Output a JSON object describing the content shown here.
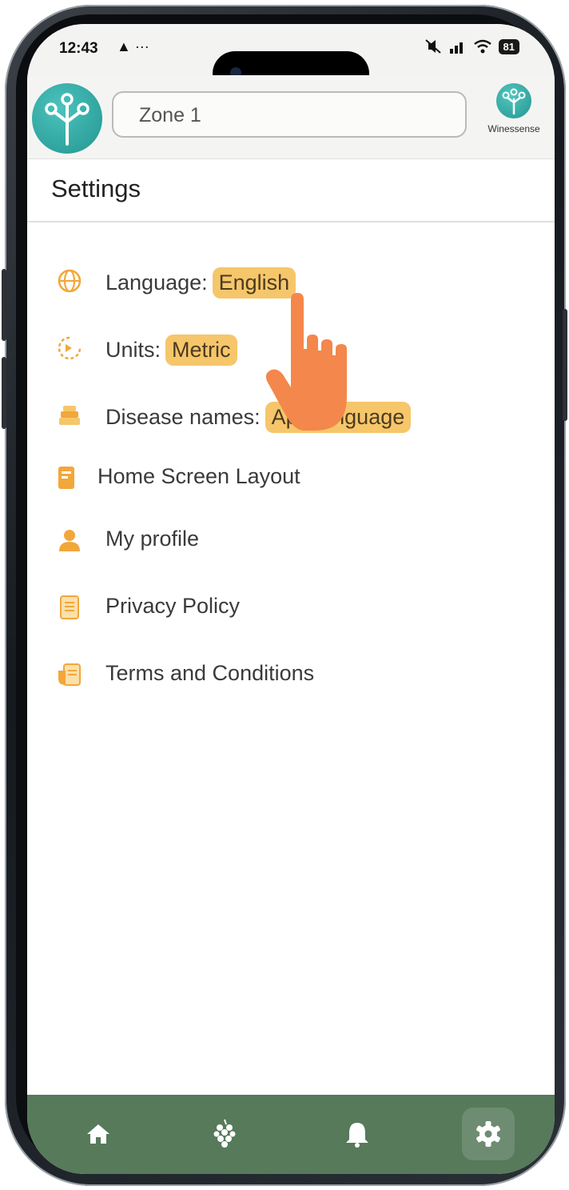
{
  "status_bar": {
    "time": "12:43",
    "indicators": "▲ ···",
    "battery": "81",
    "icons": [
      "cloud-icon",
      "mute-icon",
      "signal-icon",
      "wifi-icon",
      "battery-icon"
    ]
  },
  "header": {
    "zone_value": "Zone 1",
    "brand_name": "Winessense"
  },
  "page": {
    "title": "Settings"
  },
  "settings": {
    "items": [
      {
        "label": "Language:",
        "value": "English",
        "icon": "globe-icon"
      },
      {
        "label": "Units:",
        "value": "Metric",
        "icon": "gauge-icon"
      },
      {
        "label": "Disease names:",
        "value": "App language",
        "icon": "books-icon"
      },
      {
        "label": "Home Screen Layout",
        "icon": "layout-icon"
      },
      {
        "label": "My profile",
        "icon": "person-icon"
      },
      {
        "label": "Privacy Policy",
        "icon": "document-icon"
      },
      {
        "label": "Terms and Conditions",
        "icon": "contract-icon"
      }
    ]
  },
  "bottom_nav": {
    "items": [
      {
        "name": "home",
        "icon": "home-icon"
      },
      {
        "name": "grapes",
        "icon": "grapes-icon"
      },
      {
        "name": "notifications",
        "icon": "bell-icon"
      },
      {
        "name": "settings",
        "icon": "gear-icon",
        "active": true
      }
    ]
  },
  "colors": {
    "chip": "#f6c66a",
    "accent_orange": "#f2a73a",
    "nav_bg": "#567a5a",
    "logo_teal": "#2aa39c",
    "hand": "#f4874b"
  }
}
